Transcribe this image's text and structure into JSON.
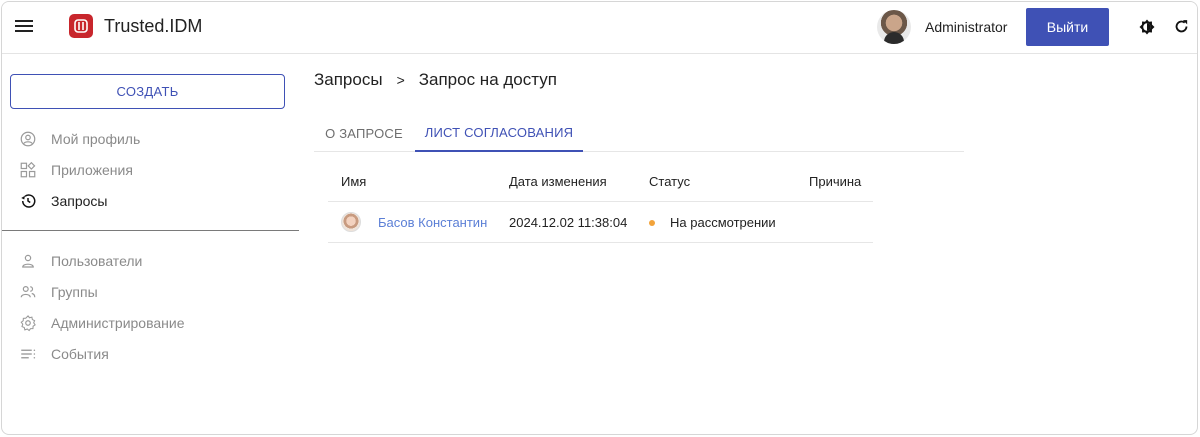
{
  "header": {
    "app_title": "Trusted.IDM",
    "username": "Administrator",
    "logout_label": "Выйти",
    "menu_icon": "hamburger-menu-icon",
    "logo_icon": "trusted-logo-icon",
    "theme_icon": "brightness-icon",
    "refresh_icon": "refresh-icon"
  },
  "sidebar": {
    "create_label": "СОЗДАТЬ",
    "items_top": [
      {
        "label": "Мой профиль",
        "icon": "account-circle-icon",
        "active": false
      },
      {
        "label": "Приложения",
        "icon": "apps-icon",
        "active": false
      },
      {
        "label": "Запросы",
        "icon": "history-icon",
        "active": true
      }
    ],
    "items_bottom": [
      {
        "label": "Пользователи",
        "icon": "user-icon"
      },
      {
        "label": "Группы",
        "icon": "group-icon"
      },
      {
        "label": "Администрирование",
        "icon": "settings-icon"
      },
      {
        "label": "События",
        "icon": "events-list-icon"
      }
    ]
  },
  "breadcrumb": {
    "parent": "Запросы",
    "separator": ">",
    "current": "Запрос на доступ"
  },
  "tabs": [
    {
      "label": "О ЗАПРОСЕ",
      "active": false
    },
    {
      "label": "ЛИСТ СОГЛАСОВАНИЯ",
      "active": true
    }
  ],
  "table": {
    "columns": [
      "Имя",
      "Дата изменения",
      "Статус",
      "Причина"
    ],
    "rows": [
      {
        "name": "Басов Константин",
        "date": "2024.12.02 11:38:04",
        "status": "На рассмотрении",
        "reason": ""
      }
    ]
  },
  "colors": {
    "accent": "#3f51b5",
    "logo": "#c8262c",
    "link": "#5b7fd6",
    "status_pending": "#f2a33a"
  }
}
